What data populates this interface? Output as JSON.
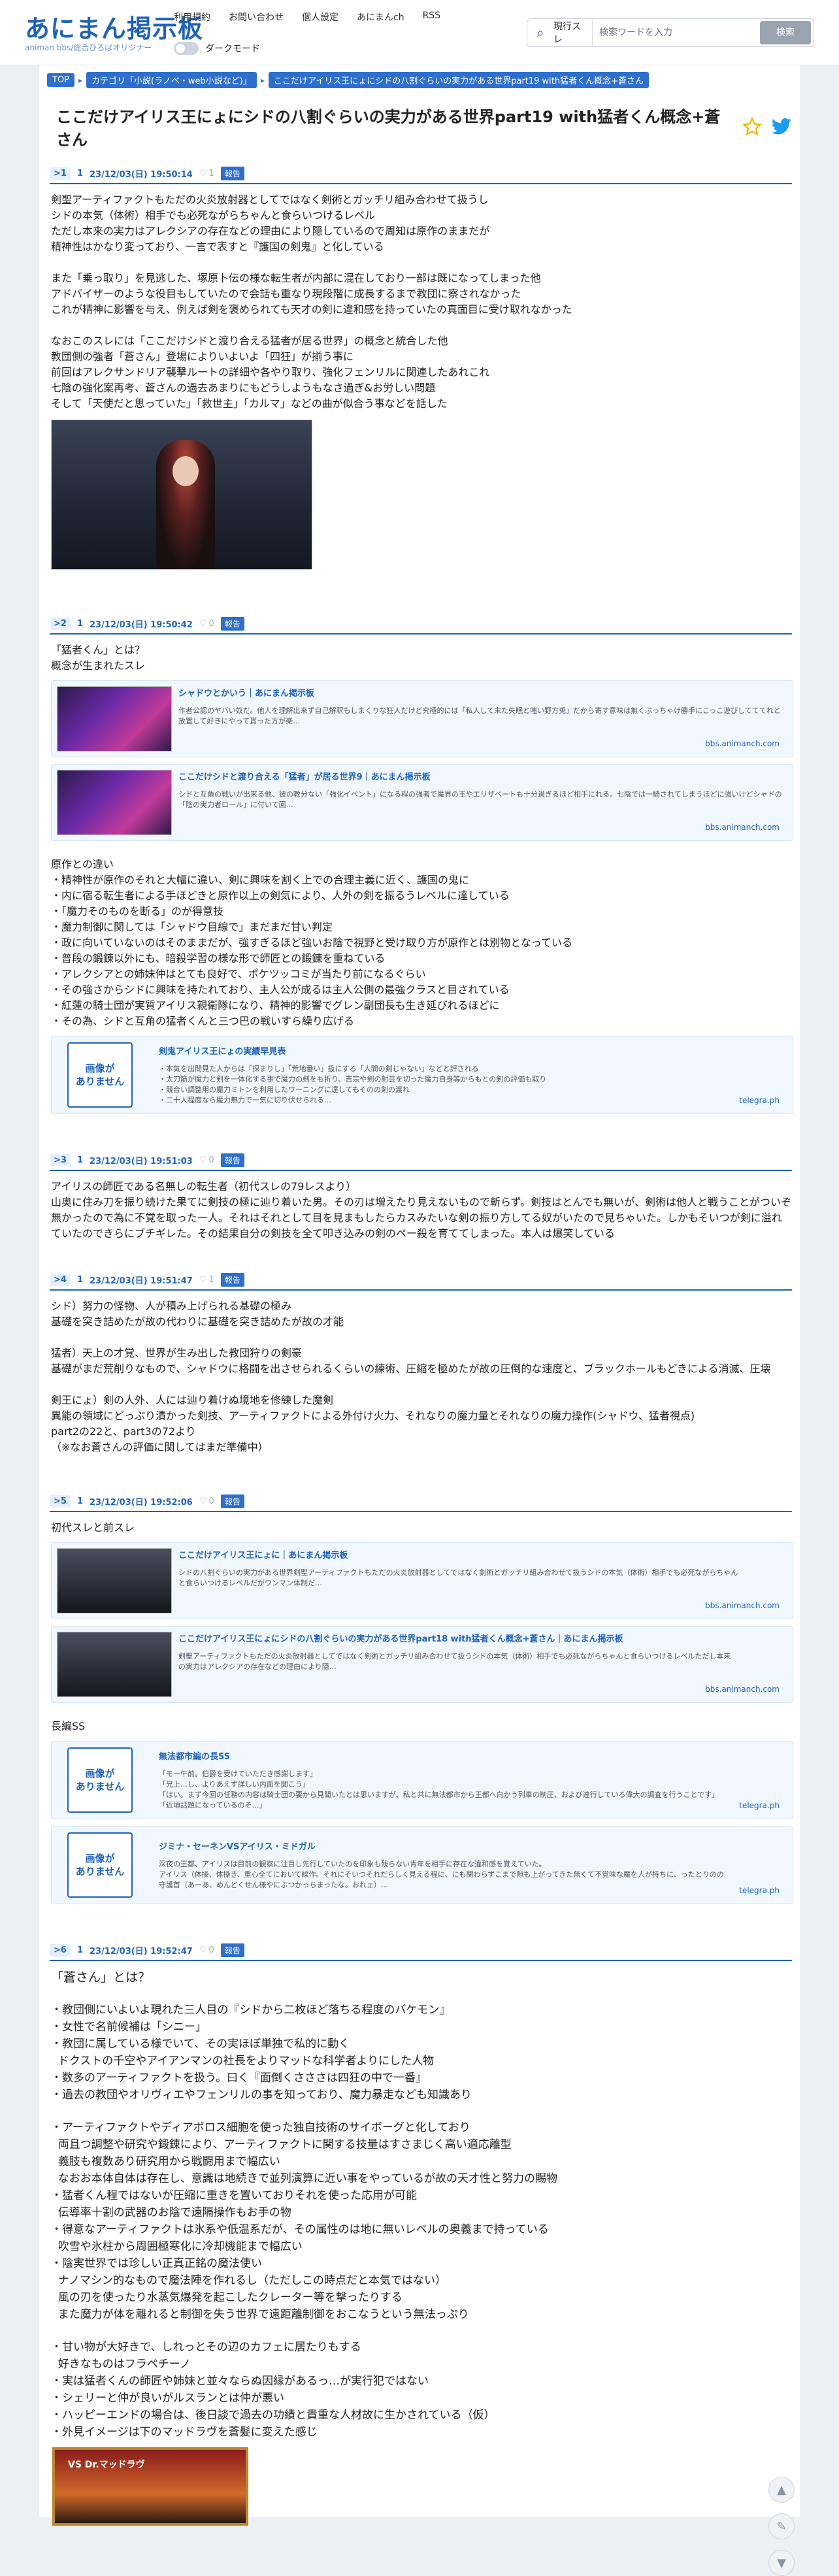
{
  "header": {
    "logo_main": "あにまん掲示板",
    "logo_sub": "animan bbs/総合ひろばオリジナー",
    "nav": [
      "利用規約",
      "お問い合わせ",
      "個人設定",
      "あにまんch",
      "RSS"
    ],
    "dark_mode_label": "ダークモード",
    "search_scope": "現行スレ",
    "search_placeholder": "検索ワードを入力",
    "search_button": "検索"
  },
  "breadcrumb": [
    "TOP",
    "カテゴリ「小説(ラノベ・web小説など)」",
    "ここだけアイリス王にょにシドの八割ぐらいの実力がある世界part19 with猛者くん概念+蒼さん"
  ],
  "thread_title": "ここだけアイリス王にょにシドの八割ぐらいの実力がある世界part19 with猛者くん概念+蒼さん",
  "report_label": "報告",
  "posts": [
    {
      "no": "1",
      "name": "1",
      "date": "23/12/03(日) 19:50:14",
      "likes": "1",
      "lines": [
        "剣聖アーティファクトもただの火炎放射器としてではなく剣術とガッチリ組み合わせて扱うし",
        "シドの本気（体術）相手でも必死ながらちゃんと食らいつけるレベル",
        "ただし本来の実力はアレクシアの存在などの理由により隠しているので周知は原作のままだが",
        "精神性はかなり変っており、一言で表すと『護国の剣鬼』と化している",
        "",
        "また「乗っ取り」を見逃した、塚原卜伝の様な転生者が内部に混在しており一部は既になってしまった他",
        "アドバイザーのような役目もしていたので会話も重なり現段階に成長するまで教団に察されなかった",
        "これが精神に影響を与え、例えば剣を褒められても天才の剣に違和感を持っていたの真面目に受け取れなかった",
        "",
        "なおこのスレには「ここだけシドと渡り合える猛者が居る世界」の概念と統合した他",
        "教団側の強者「蒼さん」登場によりいよいよ「四狂」が揃う事に",
        "前回はアレクサンドリア襲撃ルートの詳細や各やり取り、強化フェンリルに関連したあれこれ",
        "七陰の強化案再考、蒼さんの過去あまりにもどうしようもなさ過ぎ&お労しい問題",
        "そして「天使だと思っていた」「救世主」「カルマ」などの曲が似合う事などを話した"
      ]
    },
    {
      "no": "2",
      "name": "1",
      "date": "23/12/03(日) 19:50:42",
      "likes": "0",
      "intro": [
        "「猛者くん」とは？",
        "概念が生まれたスレ"
      ],
      "cards": [
        {
          "title": "シャドウとかいう｜あにまん掲示板",
          "desc": "作者公認のヤバい奴だ。他人を理解出来ず自己解釈もしまくりな狂人だけど究極的には「私人して末た失眠と嗤い野方兎」だから寄す意味は無くぶっちゃけ勝手にこっこ遊びしてててれと放置して好きにやって貰った方が楽…",
          "src": "bbs.animanch.com"
        },
        {
          "title": "ここだけシドと渡り合える「猛者」が居る世界9｜あにまん掲示板",
          "desc": "シドと互角の戦いが出来る他、彼の教分ない「強化イベント」になる程の強者で魔界の王やエリザベートも十分過ぎるほど相手にれる。七陰では一騎されてしまうほどに強いけどシャドの「陰の実力者ロール」に付いて回…",
          "src": "bbs.animanch.com"
        }
      ],
      "diffs_title": "原作との違い",
      "diffs": [
        "・精神性が原作のそれと大幅に違い、剣に興味を割く上での合理主義に近く、護国の鬼に",
        "・内に宿る転生者による手ほどきと原作以上の剣気により、人外の剣を振るうレベルに達している",
        "・「魔力そのものを断る」のが得意技",
        "・魔力制御に関しては「シャドウ目線で」まだまだ甘い判定",
        "・政に向いていないのはそのままだが、強すぎるほど強いお陰で視野と受け取り方が原作とは別物となっている",
        "・普段の鍛錬以外にも、暗殺学習の様な形で師匠との鍛錬を重ねている",
        "・アレクシアとの姉妹仲はとても良好で、ポケツッコミが当たり前になるぐらい",
        "・その強さからシドに興味を持たれており、主人公が成るは主人公側の最強クラスと目されている",
        "・紅蓮の騎士団が実質アイリス親衛隊になり、精神的影響でグレン副団長も生き延びれるほどに",
        "・その為、シドと互角の猛者くんと三つ巴の戦いすら繰り広げる"
      ],
      "noimg_card": {
        "noimg_label": "画像が\nありません",
        "title": "剣鬼アイリス王にょの実績早見表",
        "desc": "・本気を出間見た人からは「探まりし」「荒地番い」扱にする「人間の剣じゃない」などと評される\n・太刀筋が魔力と剣を一体化する事で魔力の剣をも折り、吉宗や剣の射芸を切った魔力自身等からもとの剣の評価も取り\n・競合い調整用の魔力ミトンを利用したワーニングに達してもそのの剣の渡れ\n・二十人程度なら魔力無力で一気に切り伏せられる…",
        "src": "telegra.ph"
      }
    },
    {
      "no": "3",
      "name": "1",
      "date": "23/12/03(日) 19:51:03",
      "likes": "0",
      "lines": [
        "アイリスの師匠である名無しの転生者（初代スレの79レスより）",
        "山奥に住み刀を振り続けた果てに剣技の極に辿り着いた男。その刃は増えたり見えないもので斬らず。剣技はとんでも無いが、剣術は他人と戦うことがついぞ無かったので為に不覚を取った一人。それはそれとして目を見まもしたらカスみたいな剣の振り方してる奴がいたので見ちゃいた。しかもそいつが剣に溢れていたのできらにブチギレた。その結果自分の剣技を全て叩き込みの剣のペー殺を育ててしまった。本人は爆笑している"
      ]
    },
    {
      "no": "4",
      "name": "1",
      "date": "23/12/03(日) 19:51:47",
      "likes": "1",
      "lines": [
        "シド）努力の怪物、人が積み上げられる基礎の極み",
        "基礎を突き詰めたが故の代わりに基礎を突き詰めたが故の才能",
        "",
        "猛者）天上の才覚、世界が生み出した教団狩りの剣豪",
        "基礎がまだ荒削りなもので、シャドウに格闘を出させられるくらいの練術、圧縮を極めたが故の圧倒的な速度と、ブラックホールもどきによる消滅、圧壊",
        "",
        "剣王にょ）剣の人外、人には辿り着けぬ境地を修練した魔剣",
        "異能の領域にどっぷり漬かった剣技、アーティファクトによる外付け火力、それなりの魔力量とそれなりの魔力操作(シャドウ、猛者視点)",
        "part2の22と、part3の72より",
        "（※なお蒼さんの評価に関してはまだ準備中）"
      ]
    },
    {
      "no": "5",
      "name": "1",
      "date": "23/12/03(日) 19:52:06",
      "likes": "0",
      "intro": [
        "初代スレと前スレ"
      ],
      "cards": [
        {
          "title": "ここだけアイリス王にょに｜あにまん掲示板",
          "desc": "シドの八割ぐらいの実力がある世界剣聖アーティファクトもただの火炎放射器としてではなく剣術とガッチリ組み合わせて扱うシドの本気（体術）相手でも必死ながらちゃん\nと食らいつけるレベルだがワンマン体制だ…",
          "src": "bbs.animanch.com"
        },
        {
          "title": "ここだけアイリス王にょにシドの八割ぐらいの実力がある世界part18 with猛者くん概念+蒼さん｜あにまん掲示板",
          "desc": "剣聖アーティファクトもただの火炎放射器としてではなく剣術とガッチリ組み合わせて扱うシドの本気（体術）相手でも必死ながらちゃんと食らいつけるレベルただし本来\nの実力はアレクシアの存在などの理由により隠…",
          "src": "bbs.animanch.com"
        }
      ],
      "sub_title": "長編SS",
      "noimg_cards": [
        {
          "noimg_label": "画像が\nありません",
          "title": "無法都市編の長SS",
          "desc": "「モー午前。伯爵を受けていただき感謝します」\n「兄上…し、よりあえず詳しい内面を聞こう」\n「はい。まず今回の任務の内容は騎士団の要から見聞いたとは思いますが、私と共に無法都市から王都へ向かう列車の制圧、および連行している偉大の調査を行うことです」\n「近頃話題になっているのそ…」",
          "src": "telegra.ph"
        },
        {
          "noimg_label": "画像が\nありません",
          "title": "ジミナ・セーネンVSアイリス・ミドガル",
          "desc": "深夜の王都、アイリスは目前の観察に注目し先行していたのを印象も残らない青年を相手に存在な違和感を覚えていた。\nアイリス（体操、体操き、重心全てにおいて線作。それにそいつそれだらしく見える程に、にも関わらずこまで隙も上がってきた無くて不覚味な魔を人が持ちに、ったとりのの\n守護首（あーあ、めんどくせん様やにぶつかっちまったな。おれェ）…",
          "src": "telegra.ph"
        }
      ]
    },
    {
      "no": "6",
      "name": "1",
      "date": "23/12/03(日) 19:52:47",
      "likes": "0",
      "intro": [
        "「蒼さん」とは？"
      ],
      "lines": [
        "",
        "・教団側にいよいよ現れた三人目の『シドから二枚ほど落ちる程度のバケモン』",
        "・女性で名前候補は「シニー」",
        "・教団に属している様でいて、その実ほぼ単独で私的に動く",
        "  ドクストの千空やアイアンマンの社長をよりマッドな科学者よりにした人物",
        "・数多のアーティファクトを扱う。曰く『面倒くさささは四狂の中で一番』",
        "・過去の教団やオリヴィエやフェンリルの事を知っており、魔力暴走なども知識あり",
        "",
        "・アーティファクトやディアボロス細胞を使った独自技術のサイボーグと化しており",
        "  両且つ調整や研究や鍛錬により、アーティファクトに関する技量はすさまじく高い適応離型",
        "  義肢も複数あり研究用から戦闘用まで幅広い",
        "  なおお本体自体は存在し、意識は地続きで並列演算に近い事をやっているが故の天才性と努力の賜物",
        "・猛者くん程ではないが圧縮に重きを置いておりそれを使った応用が可能",
        "  伝導率十割の武器のお陰で遠隔操作もお手の物",
        "・得意なアーティファクトは氷系や低温系だが、その属性のは地に無いレベルの奥義まで持っている",
        "  吹雪や氷柱から周囲極寒化に冷却機能まで幅広い",
        "・陰実世界では珍しい正真正銘の魔法使い",
        "  ナノマシン的なもので魔法陣を作れるし（ただしこの時点だと本気ではない）",
        "  風の刃を使ったり水蒸気爆発を起こしたクレーター等を撃ったりする",
        "  また魔力が体を離れると制御を失う世界で遠距離制御をおこなうという無法っぷり",
        "",
        "・甘い物が大好きで、しれっとその辺のカフェに居たりもする",
        "  好きなものはフラペチーノ",
        "・実は猛者くんの師匠や姉妹と並々ならぬ因縁があるっ…が実行犯ではない",
        "・シェリーと仲が良いがルスランとは仲が悪い",
        "・ハッピーエンドの場合は、後日談で過去の功績と貴重な人材故に生かされている（仮）",
        "・外見イメージは下のマッドラヴを蒼髪に変えた感じ"
      ],
      "image_label": "VS Dr.マッドラヴ"
    }
  ],
  "side_icons": [
    "arrow-up-icon",
    "pencil-icon",
    "arrow-down-icon"
  ]
}
